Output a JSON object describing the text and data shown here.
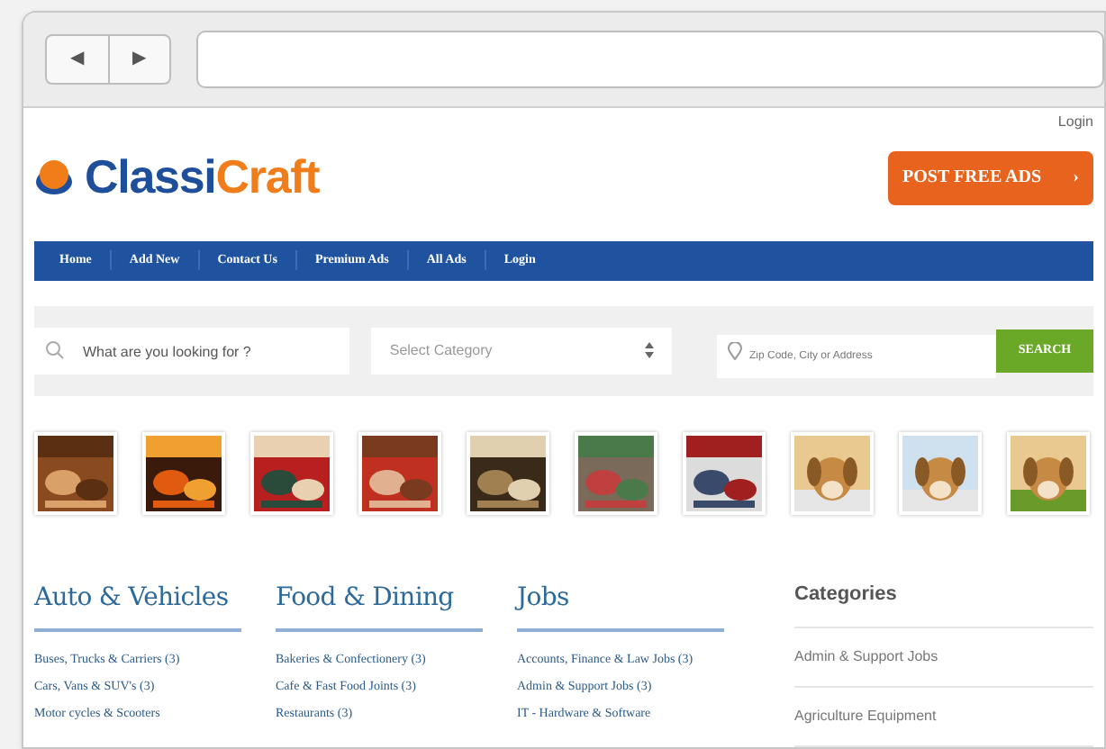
{
  "browser": {
    "back": "◀",
    "forward": "▶"
  },
  "header": {
    "login": "Login",
    "logo_part_1": "Classi",
    "logo_part_2": "Craft",
    "post_button": "POST FREE ADS",
    "post_arrow": "›"
  },
  "nav": [
    {
      "label": "Home"
    },
    {
      "label": "Add New"
    },
    {
      "label": "Contact Us"
    },
    {
      "label": "Premium Ads"
    },
    {
      "label": "All Ads"
    },
    {
      "label": "Login"
    }
  ],
  "search": {
    "keyword_placeholder": "What are you looking for ?",
    "category_placeholder": "Select Category",
    "location_placeholder": "Zip Code, City or Address",
    "button": "SEARCH"
  },
  "thumbnails": [
    {
      "kind": "food"
    },
    {
      "kind": "food"
    },
    {
      "kind": "food"
    },
    {
      "kind": "food"
    },
    {
      "kind": "food"
    },
    {
      "kind": "food"
    },
    {
      "kind": "food"
    },
    {
      "kind": "dog"
    },
    {
      "kind": "dog"
    },
    {
      "kind": "dog"
    }
  ],
  "columns": [
    {
      "title": "Auto & Vehicles",
      "items": [
        "Buses, Trucks & Carriers (3)",
        "Cars, Vans & SUV's (3)",
        "Motor cycles & Scooters"
      ]
    },
    {
      "title": "Food & Dining",
      "items": [
        "Bakeries & Confectionery (3)",
        "Cafe & Fast Food Joints (3)",
        "Restaurants (3)"
      ]
    },
    {
      "title": "Jobs",
      "items": [
        "Accounts, Finance & Law Jobs (3)",
        "Admin & Support Jobs (3)",
        "IT - Hardware & Software"
      ]
    }
  ],
  "sidebar": {
    "title": "Categories",
    "items": [
      "Admin & Support Jobs",
      "Agriculture Equipment"
    ]
  }
}
